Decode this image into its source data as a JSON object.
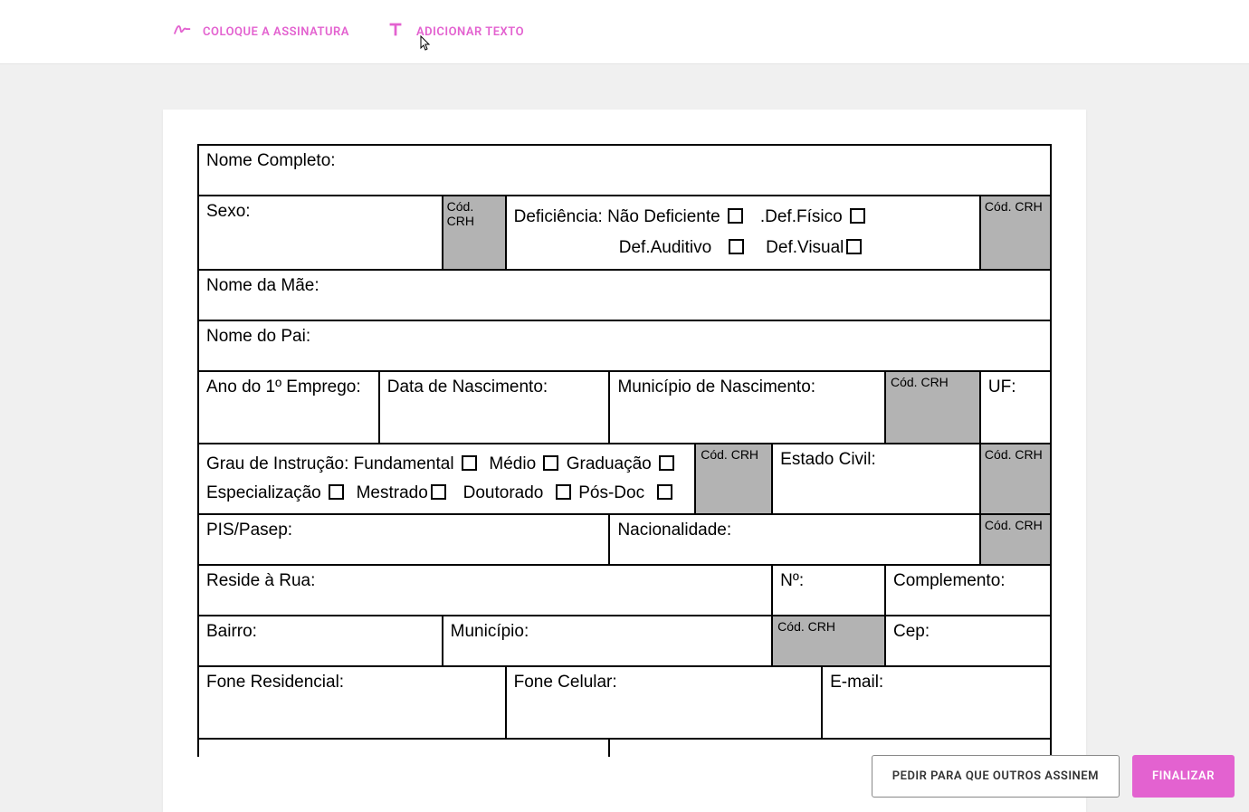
{
  "toolbar": {
    "signature_label": "COLOQUE A ASSINATURA",
    "text_label": "ADICIONAR TEXTO"
  },
  "form": {
    "nome_completo": "Nome Completo:",
    "sexo": "Sexo:",
    "cod_crh": "Cód. CRH",
    "deficiencia_label": "Deficiência: Não Deficiente",
    "def_fisico": ".Def.Físico",
    "def_auditivo": "Def.Auditivo",
    "def_visual": "Def.Visual",
    "nome_mae": "Nome da Mãe:",
    "nome_pai": "Nome do Pai:",
    "ano_emprego": "Ano do 1º Emprego:",
    "data_nascimento": "Data de Nascimento:",
    "municipio_nascimento": "Município de Nascimento:",
    "uf": "UF:",
    "grau_instrucao": "Grau de Instrução:",
    "fundamental": "Fundamental",
    "medio": "Médio",
    "graduacao": "Graduação",
    "especializacao": "Especialização",
    "mestrado": "Mestrado",
    "doutorado": "Doutorado",
    "pos_doc": "Pós-Doc",
    "estado_civil": "Estado Civil:",
    "pis_pasep": "PIS/Pasep:",
    "nacionalidade": "Nacionalidade:",
    "reside_rua": "Reside à Rua:",
    "numero": "Nº:",
    "complemento": "Complemento:",
    "bairro": "Bairro:",
    "municipio": "Município:",
    "cep": "Cep:",
    "fone_residencial": "Fone Residencial:",
    "fone_celular": "Fone Celular:",
    "email": "E-mail:"
  },
  "footer": {
    "request_others": "PEDIR PARA QUE OUTROS ASSINEM",
    "finalize": "FINALIZAR"
  }
}
